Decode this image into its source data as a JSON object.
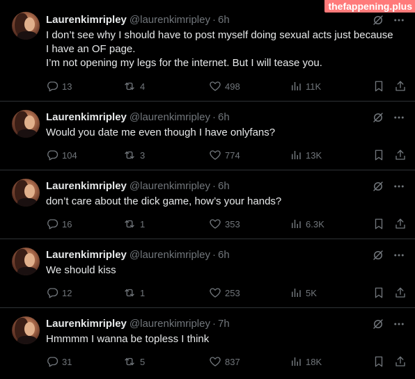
{
  "watermark": "thefappening.plus",
  "tweets": [
    {
      "name": "Laurenkimripley",
      "handle": "@laurenkimripley",
      "separator": "·",
      "time": "6h",
      "lines": [
        "I don’t see why I should have to post myself doing sexual acts just because",
        "I have an OF page.",
        "I’m not opening my legs for the internet. But I will tease you."
      ],
      "replies": "13",
      "retweets": "4",
      "likes": "498",
      "views": "11K"
    },
    {
      "name": "Laurenkimripley",
      "handle": "@laurenkimripley",
      "separator": "·",
      "time": "6h",
      "lines": [
        "Would you date me even though I have onlyfans?"
      ],
      "replies": "104",
      "retweets": "3",
      "likes": "774",
      "views": "13K"
    },
    {
      "name": "Laurenkimripley",
      "handle": "@laurenkimripley",
      "separator": "·",
      "time": "6h",
      "lines": [
        "don’t care about the dick game, how’s your hands?"
      ],
      "replies": "16",
      "retweets": "1",
      "likes": "353",
      "views": "6.3K"
    },
    {
      "name": "Laurenkimripley",
      "handle": "@laurenkimripley",
      "separator": "·",
      "time": "6h",
      "lines": [
        "We should kiss"
      ],
      "replies": "12",
      "retweets": "1",
      "likes": "253",
      "views": "5K"
    },
    {
      "name": "Laurenkimripley",
      "handle": "@laurenkimripley",
      "separator": "·",
      "time": "7h",
      "lines": [
        "Hmmmm I wanna be topless I think"
      ],
      "replies": "31",
      "retweets": "5",
      "likes": "837",
      "views": "18K"
    }
  ],
  "icons": {
    "grok": "grok-icon",
    "more": "more-icon",
    "reply": "reply-icon",
    "retweet": "retweet-icon",
    "like": "heart-icon",
    "views": "views-icon",
    "bookmark": "bookmark-icon",
    "share": "share-icon"
  },
  "colors": {
    "background": "#000000",
    "text": "#e7e9ea",
    "muted": "#71767b",
    "divider": "#2f3336",
    "watermark": "#ff7a7a"
  }
}
